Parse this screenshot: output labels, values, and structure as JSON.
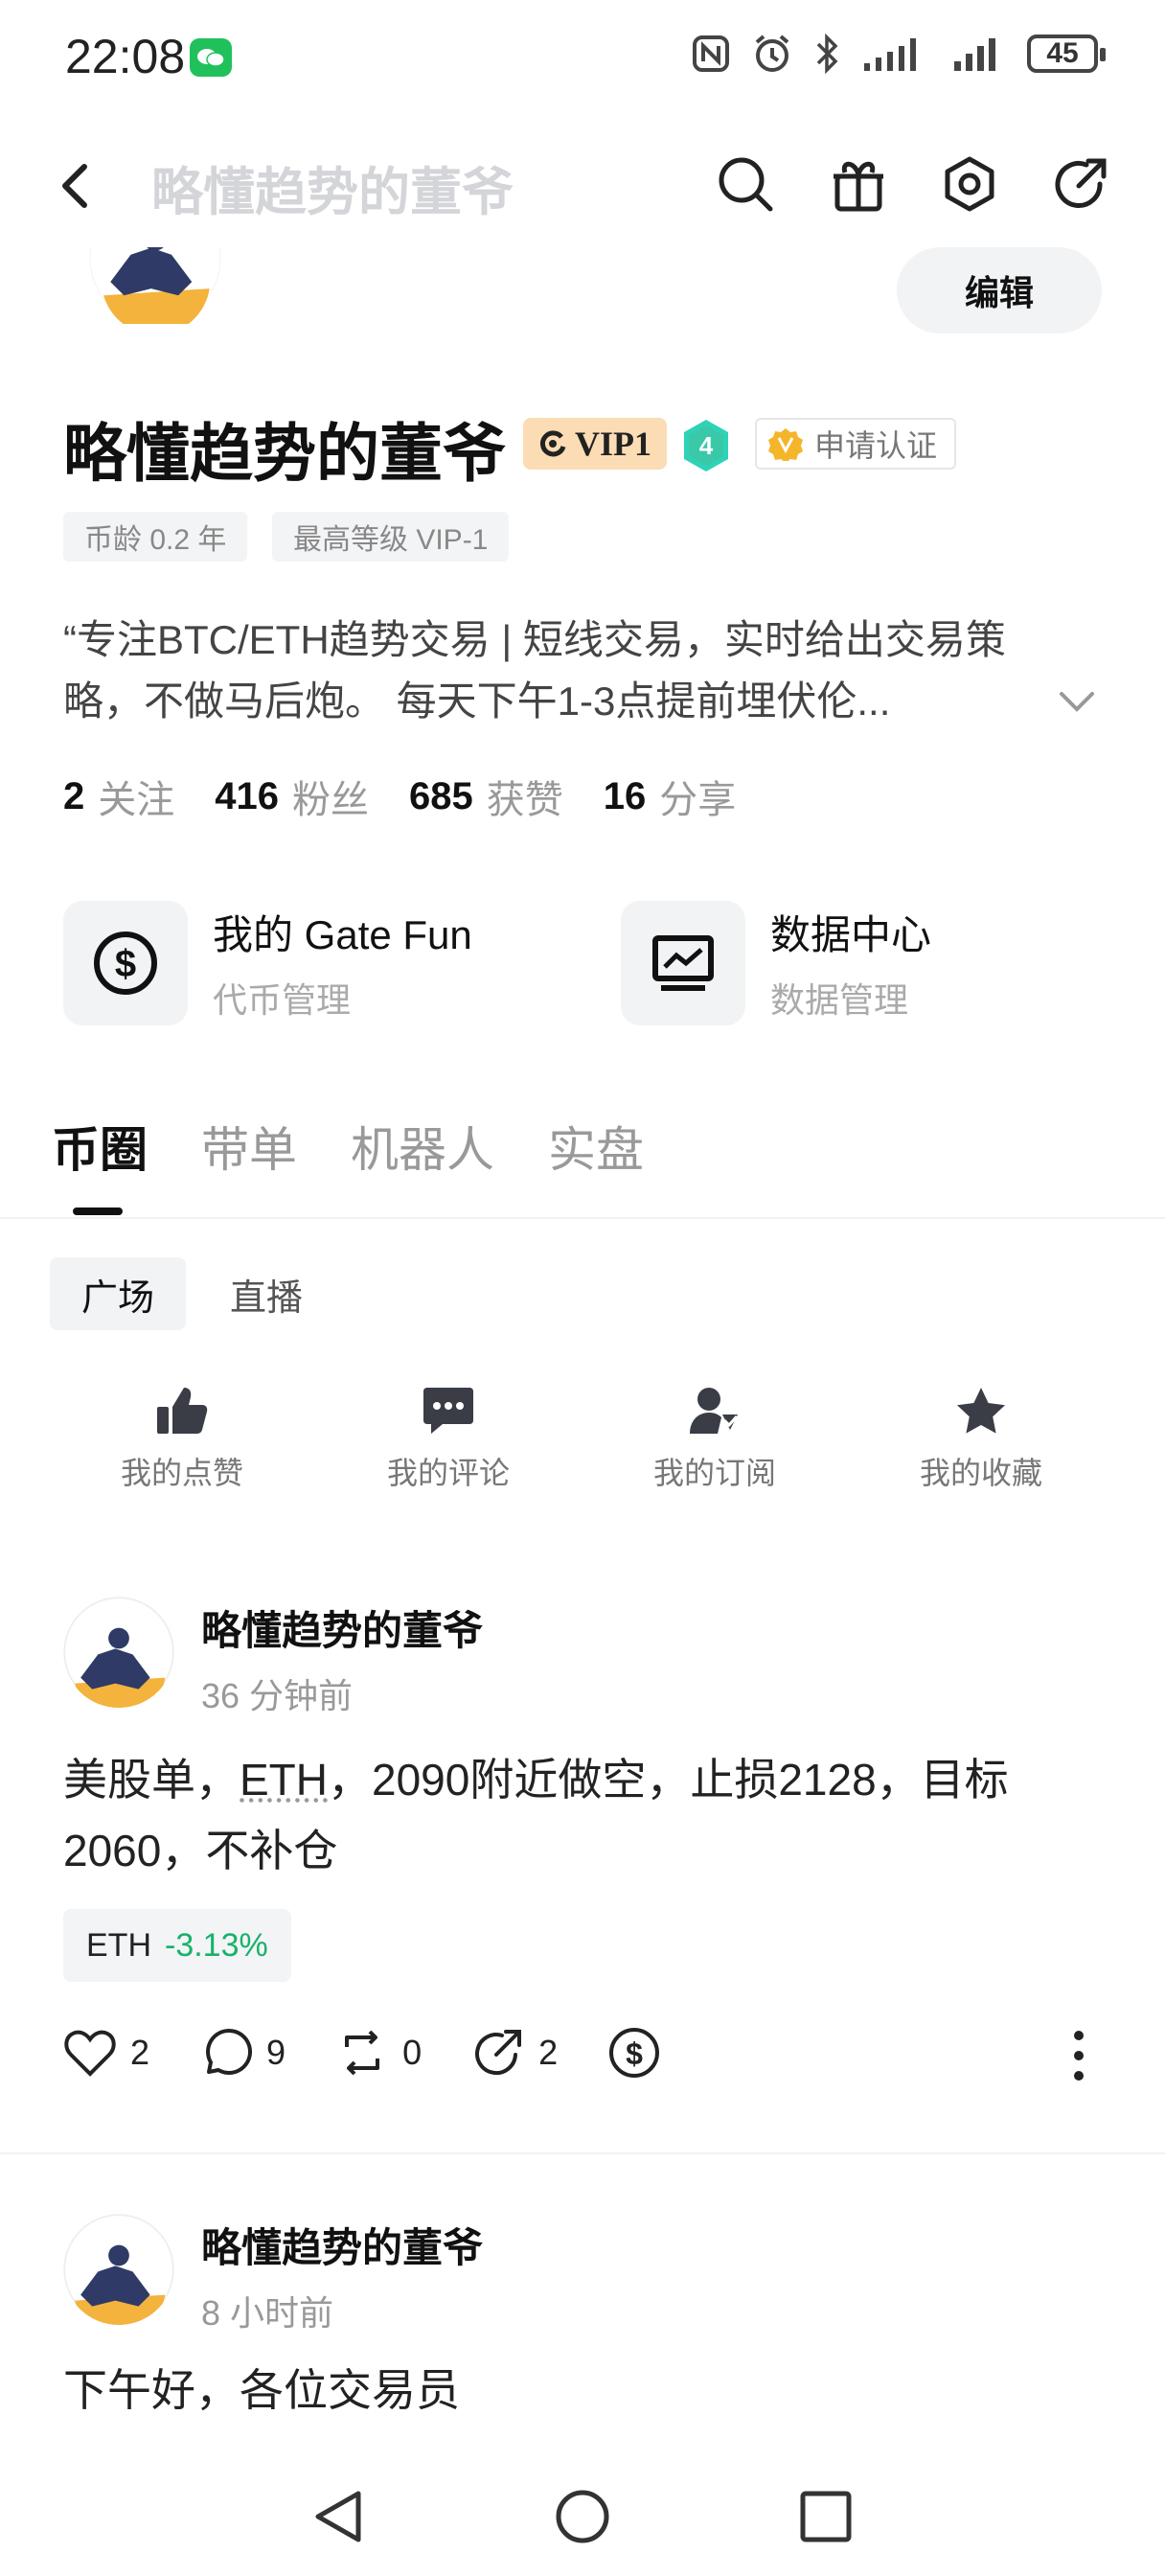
{
  "status_bar": {
    "time": "22:08",
    "battery": "45"
  },
  "nav": {
    "title": "略懂趋势的董爷"
  },
  "profile": {
    "edit_label": "编辑",
    "name": "略懂趋势的董爷",
    "vip": "VIP1",
    "level": "4",
    "verify_label": "申请认证",
    "tags": [
      "币龄 0.2 年",
      "最高等级 VIP-1"
    ],
    "bio_line1": "“专注BTC/ETH趋势交易 | 短线交易，实时给出交易策",
    "bio_line2": "略，不做马后炮。 每天下午1-3点提前埋伏伦...",
    "stats": [
      {
        "value": "2",
        "label": "关注"
      },
      {
        "value": "416",
        "label": "粉丝"
      },
      {
        "value": "685",
        "label": "获赞"
      },
      {
        "value": "16",
        "label": "分享"
      }
    ]
  },
  "tools": [
    {
      "title": "我的 Gate Fun",
      "subtitle": "代币管理",
      "icon": "dollar-circle-icon"
    },
    {
      "title": "数据中心",
      "subtitle": "数据管理",
      "icon": "chart-monitor-icon"
    }
  ],
  "main_tabs": [
    "币圈",
    "带单",
    "机器人",
    "实盘"
  ],
  "sub_tabs": [
    "广场",
    "直播"
  ],
  "quick_actions": [
    {
      "label": "我的点赞",
      "icon": "thumbs-up-icon"
    },
    {
      "label": "我的评论",
      "icon": "comment-icon"
    },
    {
      "label": "我的订阅",
      "icon": "subscribe-user-icon"
    },
    {
      "label": "我的收藏",
      "icon": "star-icon"
    }
  ],
  "posts": [
    {
      "author": "略懂趋势的董爷",
      "time": "36 分钟前",
      "text_prefix": "美股单，",
      "text_link": "ETH",
      "text_rest_line1": "，2090附近做空，止损2128，目标",
      "text_line2": "2060，不补仓",
      "coin": "ETH",
      "change": "-3.13%",
      "likes": "2",
      "comments": "9",
      "reposts": "0",
      "shares": "2"
    },
    {
      "author": "略懂趋势的董爷",
      "time": "8 小时前",
      "text": "下午好，各位交易员"
    }
  ],
  "colors": {
    "accent_green": "#17b26a",
    "vip_bg": "#fbdcb4",
    "level_teal": "#2ed3b7"
  }
}
